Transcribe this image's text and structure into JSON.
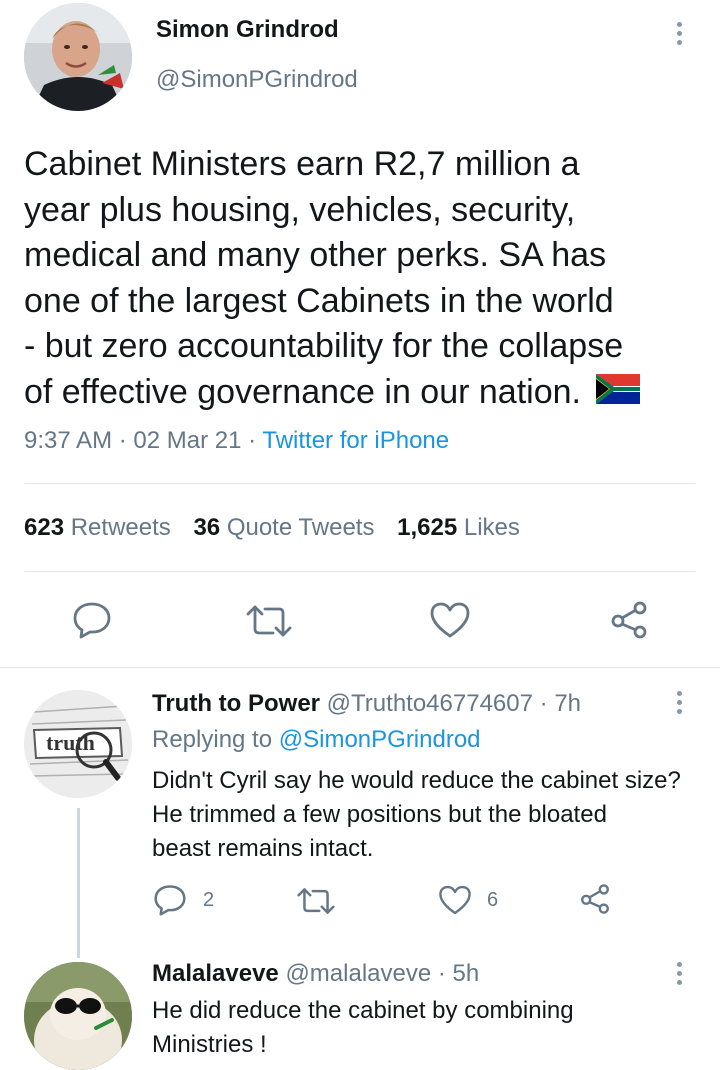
{
  "main_tweet": {
    "author_name": "Simon Grindrod",
    "handle": "@SimonPGrindrod",
    "text_lines": [
      "Cabinet Ministers earn R2,7 million a",
      "year plus housing, vehicles, security,",
      "medical and many other perks. SA has",
      "one of the largest Cabinets in the world",
      "- but zero accountability for the collapse",
      "of effective governance in our nation."
    ],
    "time": "9:37 AM",
    "date": "02 Mar 21",
    "source": "Twitter for iPhone",
    "stats": {
      "retweets_count": "623",
      "retweets_label": "Retweets",
      "quotes_count": "36",
      "quotes_label": "Quote Tweets",
      "likes_count": "1,625",
      "likes_label": "Likes"
    }
  },
  "replies": [
    {
      "author_name": "Truth to Power",
      "handle": "@Truthto46774607",
      "time_ago": "7h",
      "replying_prefix": "Replying to",
      "replying_to": "@SimonPGrindrod",
      "text_lines": [
        "Didn't Cyril say he would reduce the cabinet size?",
        "He trimmed a few positions but the bloated",
        "beast remains intact."
      ],
      "reply_count": "2",
      "like_count": "6",
      "avatar_word": "truth"
    },
    {
      "author_name": "Malalaveve",
      "handle": "@malalaveve",
      "time_ago": "5h",
      "text_lines": [
        "He did reduce the cabinet by combining",
        "Ministries !"
      ]
    }
  ],
  "colors": {
    "link_blue": "#1b95e0",
    "muted_gray": "#657786",
    "icon_gray": "#657786",
    "divider": "#e1e8ed"
  }
}
